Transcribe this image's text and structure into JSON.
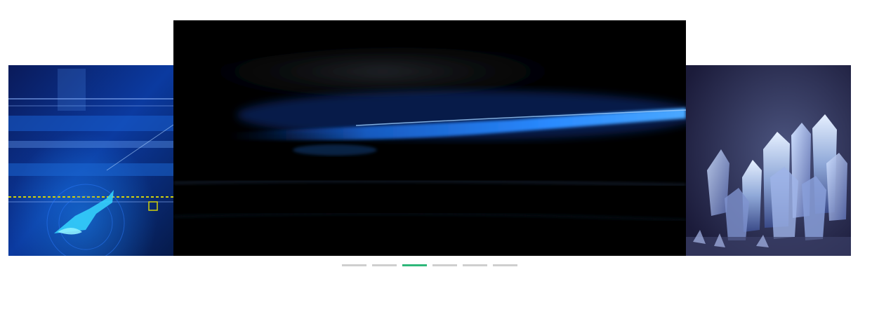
{
  "carousel": {
    "slides": [
      {
        "name": "tech-circuit-blue",
        "position": "left"
      },
      {
        "name": "blue-light-streak",
        "position": "center"
      },
      {
        "name": "blue-crystals",
        "position": "right"
      }
    ],
    "indicators": {
      "count": 6,
      "active_index": 2
    },
    "colors": {
      "indicator_inactive": "#cfcfcf",
      "indicator_active": "#2fb87a",
      "background": "#ffffff"
    }
  }
}
